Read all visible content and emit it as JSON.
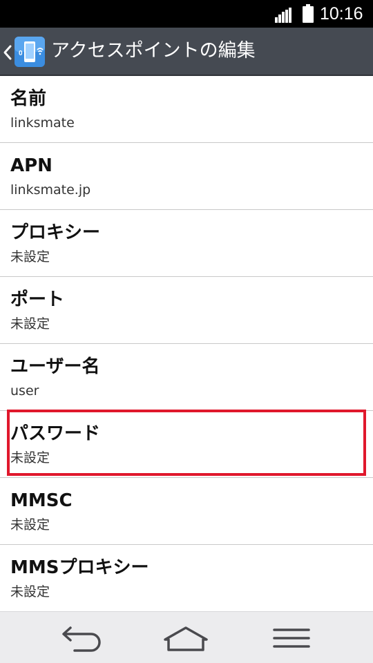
{
  "status_bar": {
    "time": "10:16"
  },
  "action_bar": {
    "title": "アクセスポイントの編集"
  },
  "apn_fields": [
    {
      "label": "名前",
      "value": "linksmate"
    },
    {
      "label": "APN",
      "value": "linksmate.jp"
    },
    {
      "label": "プロキシー",
      "value": "未設定"
    },
    {
      "label": "ポート",
      "value": "未設定"
    },
    {
      "label": "ユーザー名",
      "value": "user"
    },
    {
      "label": "パスワード",
      "value": "未設定"
    },
    {
      "label": "MMSC",
      "value": "未設定"
    },
    {
      "label": "MMSプロキシー",
      "value": "未設定"
    }
  ],
  "colors": {
    "highlight": "#e0182c",
    "action_bar": "#454a52",
    "app_icon": "#3b8de0"
  },
  "icons": {
    "back": "chevron-left-icon",
    "app": "phone-wifi-icon",
    "nav": [
      "back-arrow-icon",
      "home-icon",
      "menu-icon"
    ]
  }
}
